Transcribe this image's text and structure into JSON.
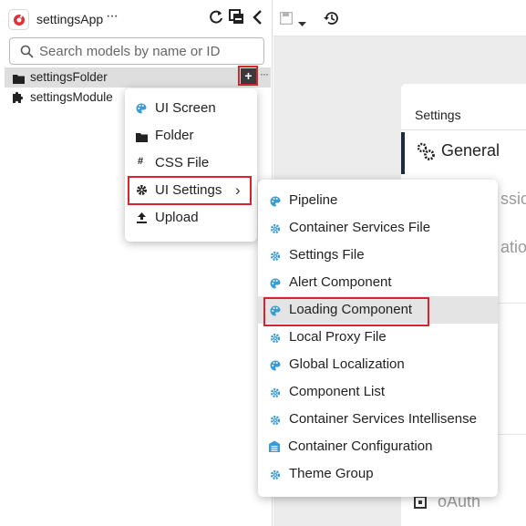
{
  "app": {
    "name": "settingsApp",
    "more": "···"
  },
  "search": {
    "placeholder": "Search models by name or ID"
  },
  "tree": [
    {
      "label": "settingsFolder",
      "icon": "folder-icon",
      "selected": true,
      "add": "+",
      "more": "···"
    },
    {
      "label": "settingsModule",
      "icon": "puzzle-icon",
      "selected": false
    }
  ],
  "new_menu": {
    "items": [
      {
        "label": "UI Screen",
        "icon": "palette-icon"
      },
      {
        "label": "Folder",
        "icon": "folder-icon"
      },
      {
        "label": "CSS File",
        "icon": "hash-icon",
        "glyph": "#"
      },
      {
        "label": "UI Settings",
        "icon": "gear-icon",
        "submenu": true,
        "highlighted": true,
        "chevron": "›"
      },
      {
        "label": "Upload",
        "icon": "upload-icon"
      }
    ]
  },
  "settings_submenu": {
    "items": [
      {
        "label": "Pipeline",
        "icon": "palette-icon"
      },
      {
        "label": "Container Services File",
        "icon": "gear-icon"
      },
      {
        "label": "Settings File",
        "icon": "gear-icon"
      },
      {
        "label": "Alert Component",
        "icon": "palette-icon"
      },
      {
        "label": "Loading Component",
        "icon": "palette-icon",
        "hovered": true,
        "highlighted": true
      },
      {
        "label": "Local Proxy File",
        "icon": "gear-icon"
      },
      {
        "label": "Global Localization",
        "icon": "palette-icon"
      },
      {
        "label": "Component List",
        "icon": "gear-icon"
      },
      {
        "label": "Container Services Intellisense",
        "icon": "gear-icon"
      },
      {
        "label": "Container Configuration",
        "icon": "database-icon"
      },
      {
        "label": "Theme Group",
        "icon": "gear-icon"
      }
    ]
  },
  "settings_panel": {
    "title": "Settings",
    "active_item": "General",
    "partial_items": [
      "ssion",
      "ation"
    ],
    "bottom_item": "oAuth"
  },
  "colors": {
    "accent_blue": "#3a9bd5",
    "highlight_red": "#d9232e",
    "active_border": "#1e2a44",
    "hover_bg": "#e4e4e4"
  }
}
